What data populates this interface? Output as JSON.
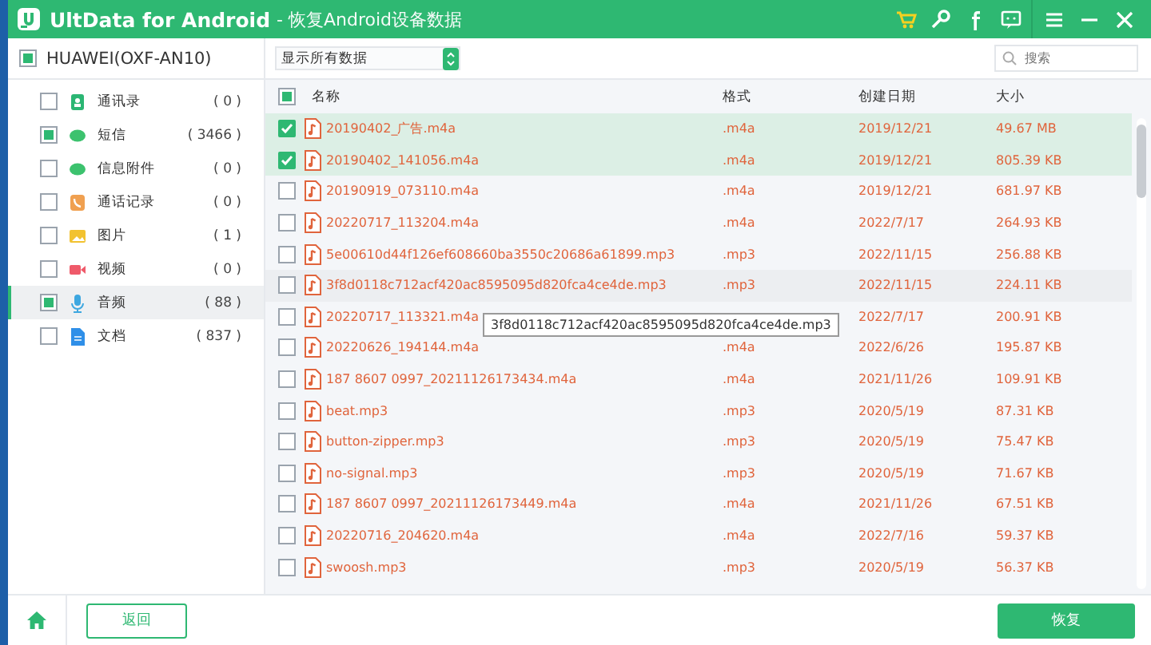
{
  "window": {
    "title": "UltData for Android",
    "subtitle": "- 恢复Android设备数据"
  },
  "device": {
    "name": "HUAWEI(OXF-AN10)",
    "checked": true
  },
  "filter": {
    "value": "显示所有数据"
  },
  "search": {
    "placeholder": "搜索"
  },
  "sidebar": {
    "items": [
      {
        "label": "通讯录",
        "count": "( 0 )",
        "checked": false,
        "selected": false,
        "color": "#2bb673"
      },
      {
        "label": "短信",
        "count": "( 3466 )",
        "checked": true,
        "selected": false,
        "color": "#3cc26e"
      },
      {
        "label": "信息附件",
        "count": "( 0 )",
        "checked": false,
        "selected": false,
        "color": "#3cc26e"
      },
      {
        "label": "通话记录",
        "count": "( 0 )",
        "checked": false,
        "selected": false,
        "color": "#f0a050"
      },
      {
        "label": "图片",
        "count": "( 1 )",
        "checked": false,
        "selected": false,
        "color": "#f2c230"
      },
      {
        "label": "视频",
        "count": "( 0 )",
        "checked": false,
        "selected": false,
        "color": "#ef5a6a"
      },
      {
        "label": "音频",
        "count": "( 88 )",
        "checked": true,
        "selected": true,
        "color": "#3da7e0"
      },
      {
        "label": "文档",
        "count": "( 837 )",
        "checked": false,
        "selected": false,
        "color": "#2f8fe8"
      }
    ]
  },
  "table": {
    "header_checked": true,
    "columns": [
      "名称",
      "格式",
      "创建日期",
      "大小"
    ],
    "rows": [
      {
        "name": "20190402_广告.m4a",
        "format": ".m4a",
        "date": "2019/12/21",
        "size": "49.67 MB",
        "selected": true
      },
      {
        "name": "20190402_141056.m4a",
        "format": ".m4a",
        "date": "2019/12/21",
        "size": "805.39 KB",
        "selected": true
      },
      {
        "name": "20190919_073110.m4a",
        "format": ".m4a",
        "date": "2019/12/21",
        "size": "681.97 KB",
        "selected": false
      },
      {
        "name": "20220717_113204.m4a",
        "format": ".m4a",
        "date": "2022/7/17",
        "size": "264.93 KB",
        "selected": false
      },
      {
        "name": "5e00610d44f126ef608660ba3550c20686a61899.mp3",
        "format": ".mp3",
        "date": "2022/11/15",
        "size": "256.88 KB",
        "selected": false
      },
      {
        "name": "3f8d0118c712acf420ac8595095d820fca4ce4de.mp3",
        "format": ".mp3",
        "date": "2022/11/15",
        "size": "224.11 KB",
        "selected": false,
        "hovered": true
      },
      {
        "name": "20220717_113321.m4a",
        "date": "2022/7/17",
        "size": "200.91 KB",
        "selected": false
      },
      {
        "name": "20220626_194144.m4a",
        "format": ".m4a",
        "date": "2022/6/26",
        "size": "195.87 KB",
        "selected": false
      },
      {
        "name": "187 8607 0997_20211126173434.m4a",
        "format": ".m4a",
        "date": "2021/11/26",
        "size": "109.91 KB",
        "selected": false
      },
      {
        "name": "beat.mp3",
        "format": ".mp3",
        "date": "2020/5/19",
        "size": "87.31 KB",
        "selected": false
      },
      {
        "name": "button-zipper.mp3",
        "format": ".mp3",
        "date": "2020/5/19",
        "size": "75.47 KB",
        "selected": false
      },
      {
        "name": "no-signal.mp3",
        "format": ".mp3",
        "date": "2020/5/19",
        "size": "71.67 KB",
        "selected": false
      },
      {
        "name": "187 8607 0997_20211126173449.m4a",
        "format": ".m4a",
        "date": "2021/11/26",
        "size": "67.51 KB",
        "selected": false
      },
      {
        "name": "20220716_204620.m4a",
        "format": ".m4a",
        "date": "2022/7/16",
        "size": "59.37 KB",
        "selected": false
      },
      {
        "name": "swoosh.mp3",
        "format": ".mp3",
        "date": "2020/5/19",
        "size": "56.37 KB",
        "selected": false
      }
    ]
  },
  "tooltip": {
    "text": "3f8d0118c712acf420ac8595095d820fca4ce4de.mp3"
  },
  "buttons": {
    "back": "返回",
    "recover": "恢复"
  }
}
